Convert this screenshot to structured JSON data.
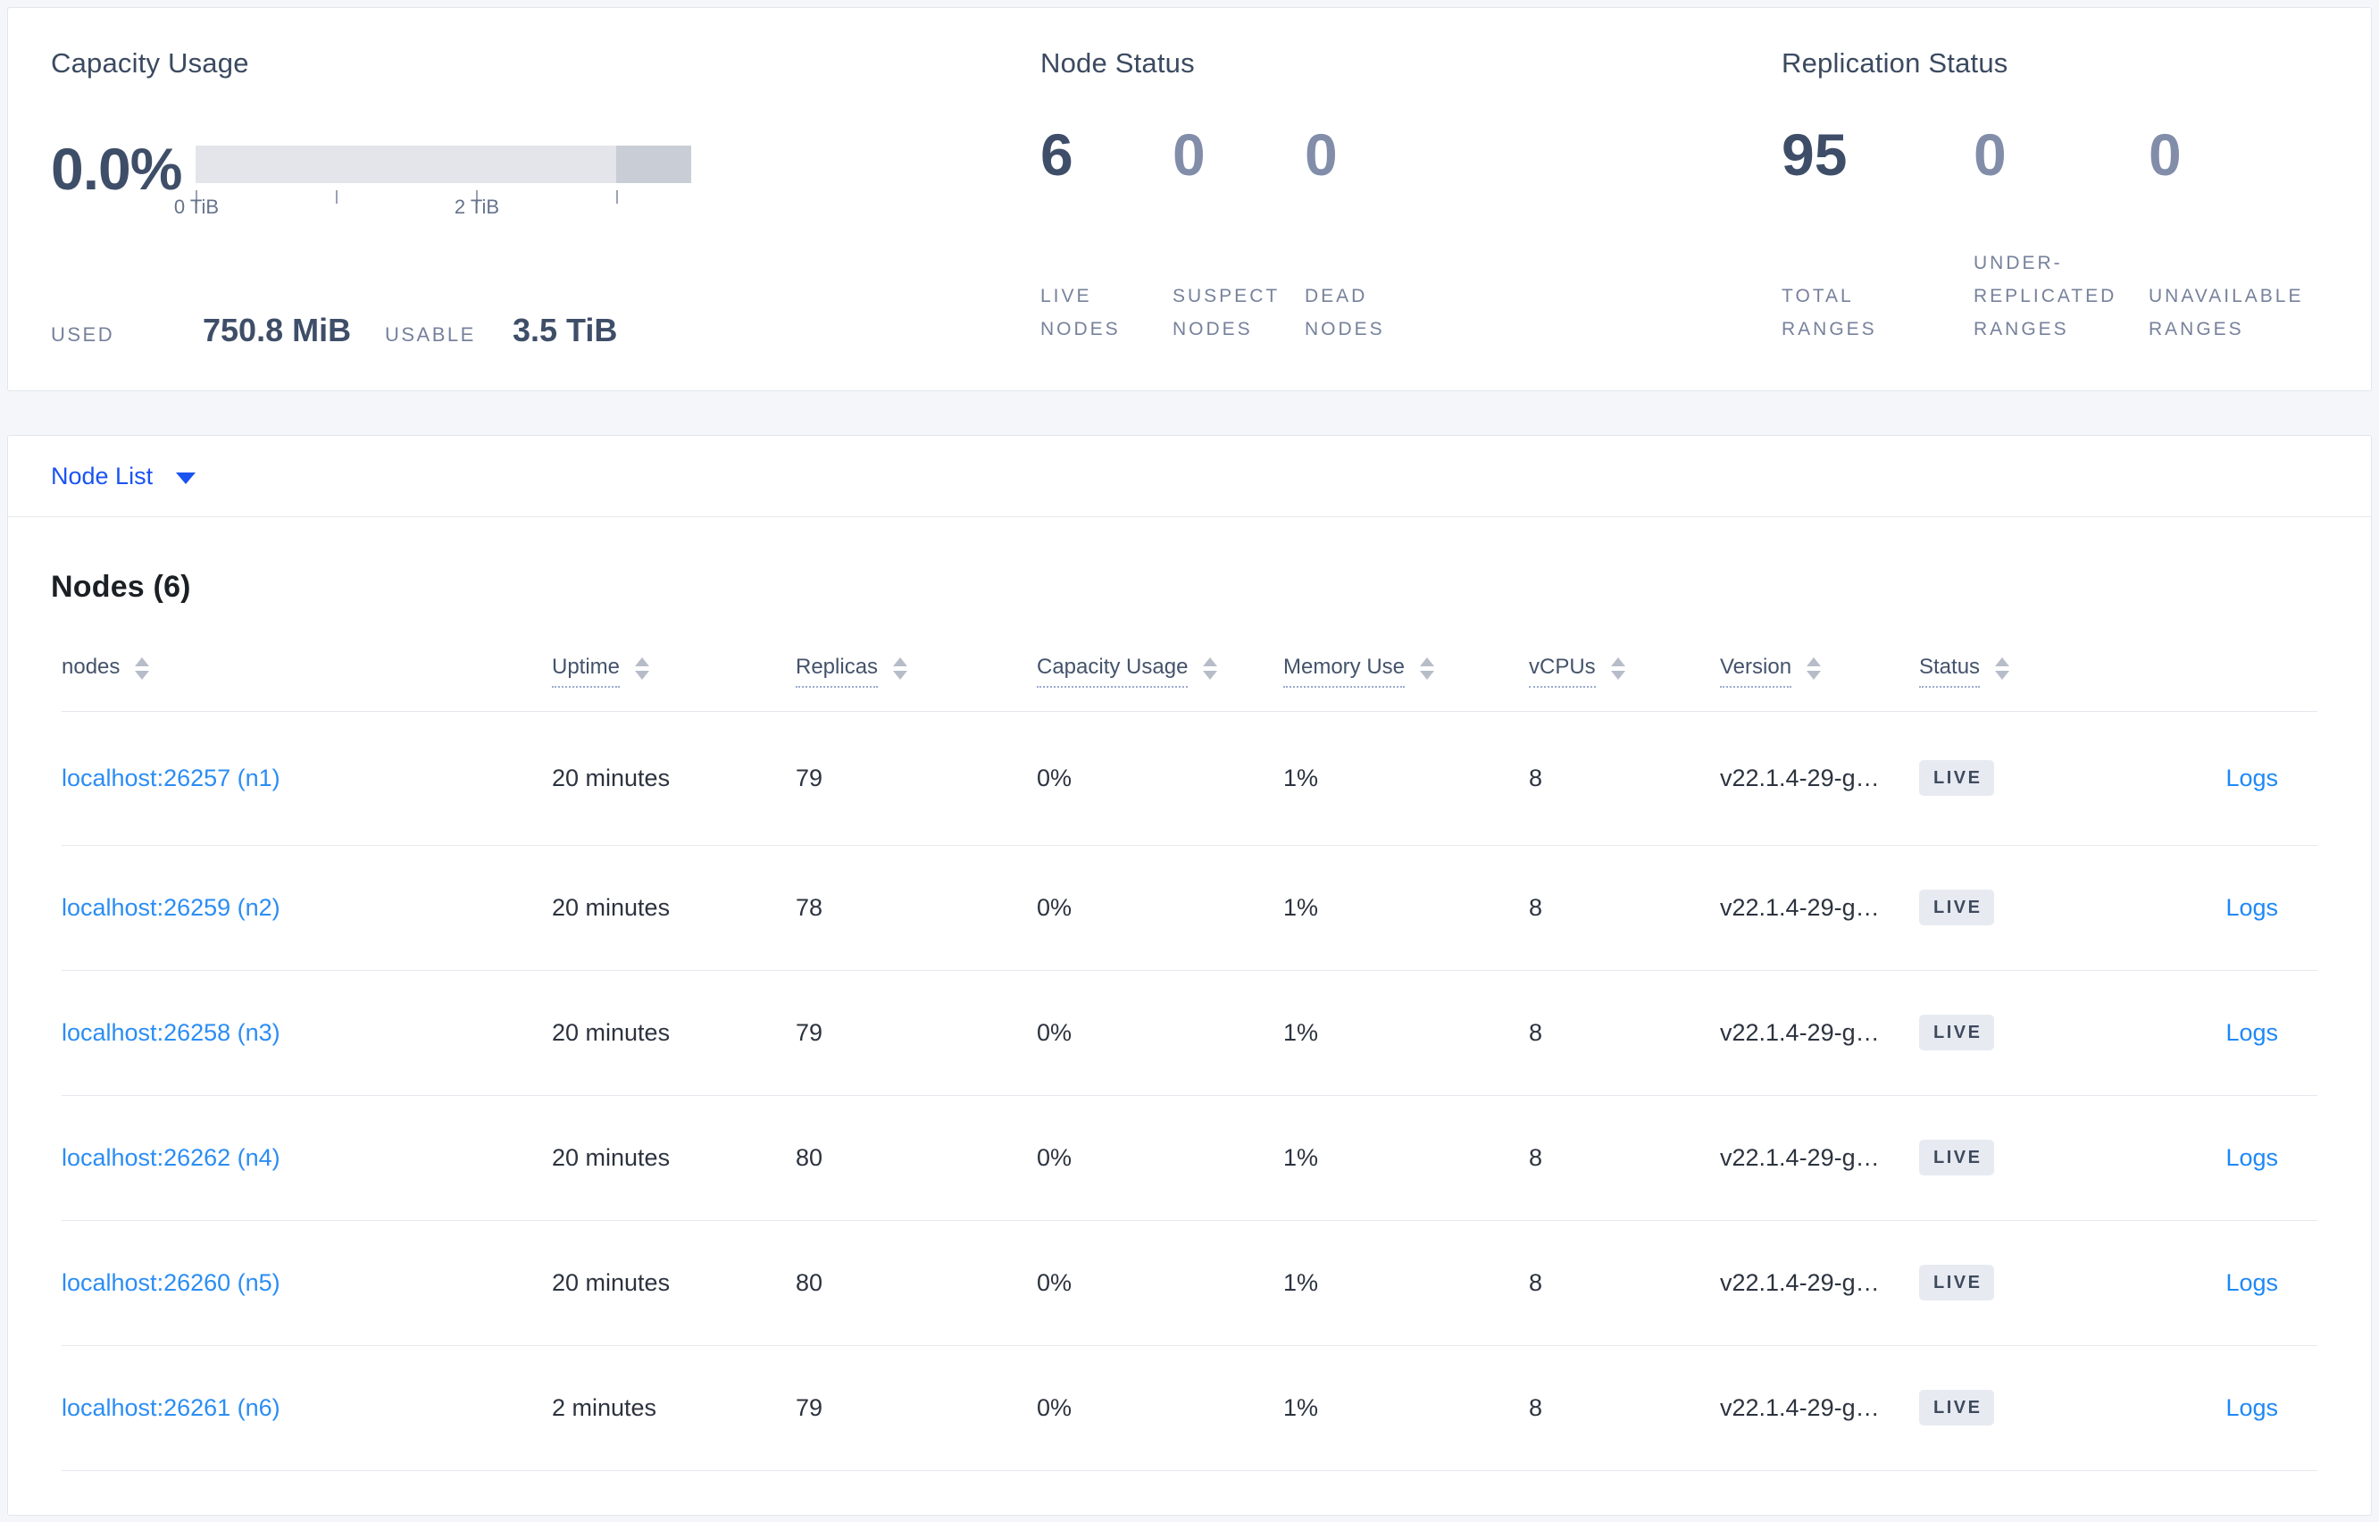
{
  "capacity": {
    "title": "Capacity Usage",
    "percent": "0.0%",
    "axis_ticks": [
      "0 TiB",
      "2 TiB"
    ],
    "used_label": "USED",
    "used_value": "750.8 MiB",
    "usable_label": "USABLE",
    "usable_value": "3.5 TiB",
    "bar_colors": {
      "track": "#e3e5ea",
      "over_capacity": "#c9cdd6"
    }
  },
  "node_status": {
    "title": "Node Status",
    "stats": [
      {
        "value": "6",
        "label": "LIVE NODES"
      },
      {
        "value": "0",
        "label": "SUSPECT NODES"
      },
      {
        "value": "0",
        "label": "DEAD NODES"
      }
    ]
  },
  "replication": {
    "title": "Replication Status",
    "stats": [
      {
        "value": "95",
        "label": "TOTAL RANGES"
      },
      {
        "value": "0",
        "label": "UNDER-REPLICATED RANGES"
      },
      {
        "value": "0",
        "label": "UNAVAILABLE RANGES"
      }
    ]
  },
  "node_list": {
    "dropdown_label": "Node List",
    "heading": "Nodes (6)",
    "columns": [
      "nodes",
      "Uptime",
      "Replicas",
      "Capacity Usage",
      "Memory Use",
      "vCPUs",
      "Version",
      "Status"
    ],
    "rows": [
      {
        "node": "localhost:26257 (n1)",
        "uptime": "20 minutes",
        "replicas": "79",
        "capacity": "0%",
        "memory": "1%",
        "vcpus": "8",
        "version": "v22.1.4-29-g…",
        "status": "LIVE",
        "logs": "Logs"
      },
      {
        "node": "localhost:26259 (n2)",
        "uptime": "20 minutes",
        "replicas": "78",
        "capacity": "0%",
        "memory": "1%",
        "vcpus": "8",
        "version": "v22.1.4-29-g…",
        "status": "LIVE",
        "logs": "Logs"
      },
      {
        "node": "localhost:26258 (n3)",
        "uptime": "20 minutes",
        "replicas": "79",
        "capacity": "0%",
        "memory": "1%",
        "vcpus": "8",
        "version": "v22.1.4-29-g…",
        "status": "LIVE",
        "logs": "Logs"
      },
      {
        "node": "localhost:26262 (n4)",
        "uptime": "20 minutes",
        "replicas": "80",
        "capacity": "0%",
        "memory": "1%",
        "vcpus": "8",
        "version": "v22.1.4-29-g…",
        "status": "LIVE",
        "logs": "Logs"
      },
      {
        "node": "localhost:26260 (n5)",
        "uptime": "20 minutes",
        "replicas": "80",
        "capacity": "0%",
        "memory": "1%",
        "vcpus": "8",
        "version": "v22.1.4-29-g…",
        "status": "LIVE",
        "logs": "Logs"
      },
      {
        "node": "localhost:26261 (n6)",
        "uptime": "2 minutes",
        "replicas": "79",
        "capacity": "0%",
        "memory": "1%",
        "vcpus": "8",
        "version": "v22.1.4-29-g…",
        "status": "LIVE",
        "logs": "Logs"
      }
    ]
  },
  "colors": {
    "accent_blue": "#1a53f0",
    "link_blue": "#2b8df3",
    "strong_number": "#3f4e68",
    "muted_number": "#828ea9",
    "badge_bg": "#e7eaf1"
  }
}
